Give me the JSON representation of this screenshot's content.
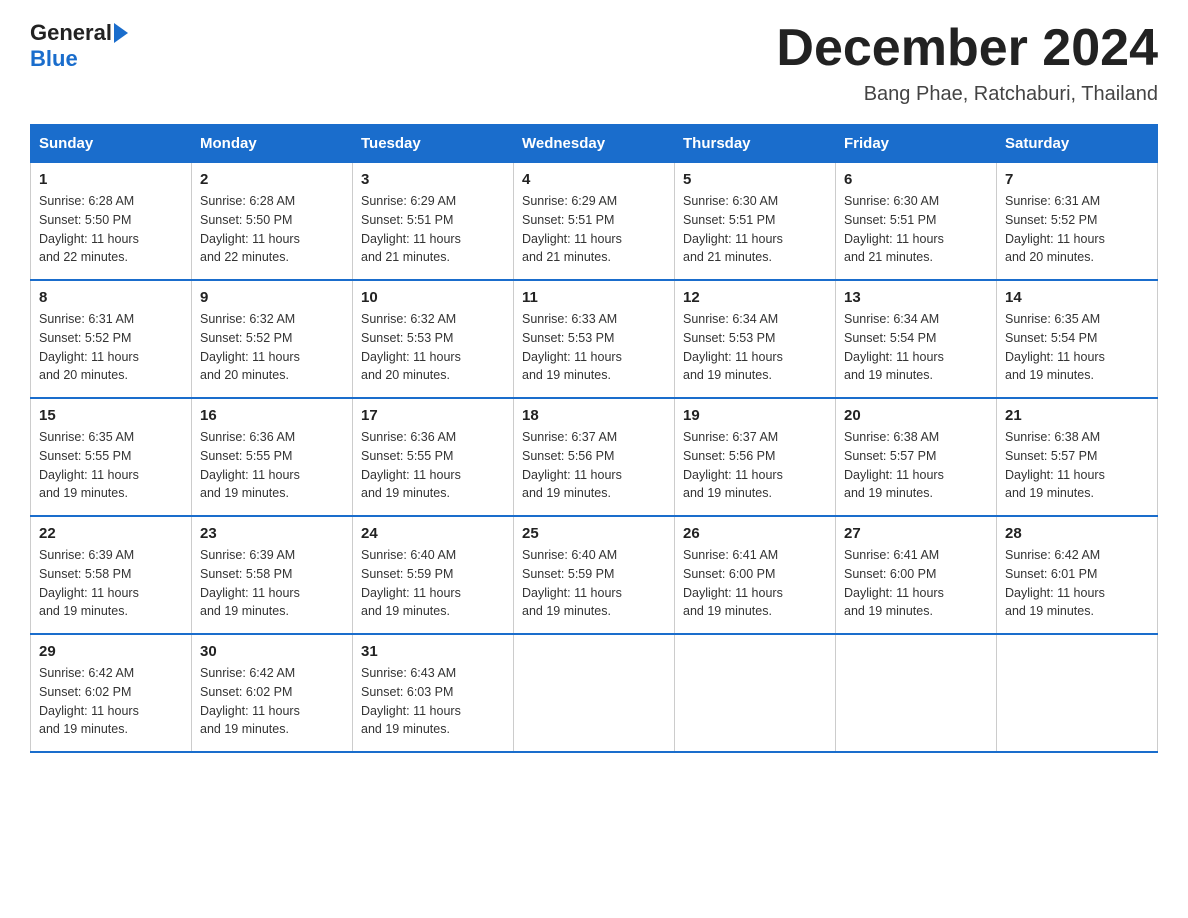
{
  "logo": {
    "text1": "General",
    "text2": "Blue"
  },
  "header": {
    "title": "December 2024",
    "location": "Bang Phae, Ratchaburi, Thailand"
  },
  "columns": [
    "Sunday",
    "Monday",
    "Tuesday",
    "Wednesday",
    "Thursday",
    "Friday",
    "Saturday"
  ],
  "weeks": [
    [
      {
        "day": "1",
        "info": "Sunrise: 6:28 AM\nSunset: 5:50 PM\nDaylight: 11 hours\nand 22 minutes."
      },
      {
        "day": "2",
        "info": "Sunrise: 6:28 AM\nSunset: 5:50 PM\nDaylight: 11 hours\nand 22 minutes."
      },
      {
        "day": "3",
        "info": "Sunrise: 6:29 AM\nSunset: 5:51 PM\nDaylight: 11 hours\nand 21 minutes."
      },
      {
        "day": "4",
        "info": "Sunrise: 6:29 AM\nSunset: 5:51 PM\nDaylight: 11 hours\nand 21 minutes."
      },
      {
        "day": "5",
        "info": "Sunrise: 6:30 AM\nSunset: 5:51 PM\nDaylight: 11 hours\nand 21 minutes."
      },
      {
        "day": "6",
        "info": "Sunrise: 6:30 AM\nSunset: 5:51 PM\nDaylight: 11 hours\nand 21 minutes."
      },
      {
        "day": "7",
        "info": "Sunrise: 6:31 AM\nSunset: 5:52 PM\nDaylight: 11 hours\nand 20 minutes."
      }
    ],
    [
      {
        "day": "8",
        "info": "Sunrise: 6:31 AM\nSunset: 5:52 PM\nDaylight: 11 hours\nand 20 minutes."
      },
      {
        "day": "9",
        "info": "Sunrise: 6:32 AM\nSunset: 5:52 PM\nDaylight: 11 hours\nand 20 minutes."
      },
      {
        "day": "10",
        "info": "Sunrise: 6:32 AM\nSunset: 5:53 PM\nDaylight: 11 hours\nand 20 minutes."
      },
      {
        "day": "11",
        "info": "Sunrise: 6:33 AM\nSunset: 5:53 PM\nDaylight: 11 hours\nand 19 minutes."
      },
      {
        "day": "12",
        "info": "Sunrise: 6:34 AM\nSunset: 5:53 PM\nDaylight: 11 hours\nand 19 minutes."
      },
      {
        "day": "13",
        "info": "Sunrise: 6:34 AM\nSunset: 5:54 PM\nDaylight: 11 hours\nand 19 minutes."
      },
      {
        "day": "14",
        "info": "Sunrise: 6:35 AM\nSunset: 5:54 PM\nDaylight: 11 hours\nand 19 minutes."
      }
    ],
    [
      {
        "day": "15",
        "info": "Sunrise: 6:35 AM\nSunset: 5:55 PM\nDaylight: 11 hours\nand 19 minutes."
      },
      {
        "day": "16",
        "info": "Sunrise: 6:36 AM\nSunset: 5:55 PM\nDaylight: 11 hours\nand 19 minutes."
      },
      {
        "day": "17",
        "info": "Sunrise: 6:36 AM\nSunset: 5:55 PM\nDaylight: 11 hours\nand 19 minutes."
      },
      {
        "day": "18",
        "info": "Sunrise: 6:37 AM\nSunset: 5:56 PM\nDaylight: 11 hours\nand 19 minutes."
      },
      {
        "day": "19",
        "info": "Sunrise: 6:37 AM\nSunset: 5:56 PM\nDaylight: 11 hours\nand 19 minutes."
      },
      {
        "day": "20",
        "info": "Sunrise: 6:38 AM\nSunset: 5:57 PM\nDaylight: 11 hours\nand 19 minutes."
      },
      {
        "day": "21",
        "info": "Sunrise: 6:38 AM\nSunset: 5:57 PM\nDaylight: 11 hours\nand 19 minutes."
      }
    ],
    [
      {
        "day": "22",
        "info": "Sunrise: 6:39 AM\nSunset: 5:58 PM\nDaylight: 11 hours\nand 19 minutes."
      },
      {
        "day": "23",
        "info": "Sunrise: 6:39 AM\nSunset: 5:58 PM\nDaylight: 11 hours\nand 19 minutes."
      },
      {
        "day": "24",
        "info": "Sunrise: 6:40 AM\nSunset: 5:59 PM\nDaylight: 11 hours\nand 19 minutes."
      },
      {
        "day": "25",
        "info": "Sunrise: 6:40 AM\nSunset: 5:59 PM\nDaylight: 11 hours\nand 19 minutes."
      },
      {
        "day": "26",
        "info": "Sunrise: 6:41 AM\nSunset: 6:00 PM\nDaylight: 11 hours\nand 19 minutes."
      },
      {
        "day": "27",
        "info": "Sunrise: 6:41 AM\nSunset: 6:00 PM\nDaylight: 11 hours\nand 19 minutes."
      },
      {
        "day": "28",
        "info": "Sunrise: 6:42 AM\nSunset: 6:01 PM\nDaylight: 11 hours\nand 19 minutes."
      }
    ],
    [
      {
        "day": "29",
        "info": "Sunrise: 6:42 AM\nSunset: 6:02 PM\nDaylight: 11 hours\nand 19 minutes."
      },
      {
        "day": "30",
        "info": "Sunrise: 6:42 AM\nSunset: 6:02 PM\nDaylight: 11 hours\nand 19 minutes."
      },
      {
        "day": "31",
        "info": "Sunrise: 6:43 AM\nSunset: 6:03 PM\nDaylight: 11 hours\nand 19 minutes."
      },
      null,
      null,
      null,
      null
    ]
  ]
}
